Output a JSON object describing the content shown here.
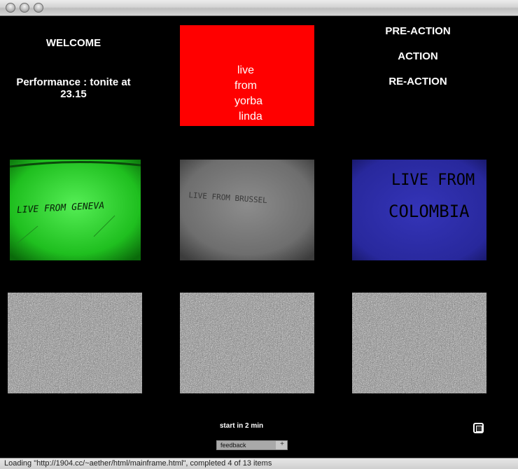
{
  "window": {
    "traffic_lights": [
      "close",
      "minimize",
      "zoom"
    ]
  },
  "left": {
    "welcome": "WELCOME",
    "performance_line1": "Performance : tonite at",
    "performance_line2": "23.15"
  },
  "center": {
    "red_lines": [
      "live",
      "from",
      "yorba",
      "linda"
    ]
  },
  "right": {
    "menu": [
      "PRE-ACTION",
      "ACTION",
      "RE-ACTION"
    ]
  },
  "videos": {
    "geneva": {
      "text": "LIVE FROM GENEVA"
    },
    "brussel": {
      "text": "LIVE FROM BRUSSEL"
    },
    "colombia": {
      "line1": "LIVE FROM",
      "line2": "COLOMBIA"
    }
  },
  "bottom": {
    "start_text": "start in 2 min",
    "feedback_placeholder": "feedback",
    "feedback_plus": "+"
  },
  "status": {
    "text": "Loading \"http://1904.cc/~aether/html/mainframe.html\", completed 4 of 13 items"
  },
  "colors": {
    "background": "#000000",
    "red_box": "#ff0000",
    "geneva": "#22cc22",
    "colombia": "#2828a0"
  }
}
